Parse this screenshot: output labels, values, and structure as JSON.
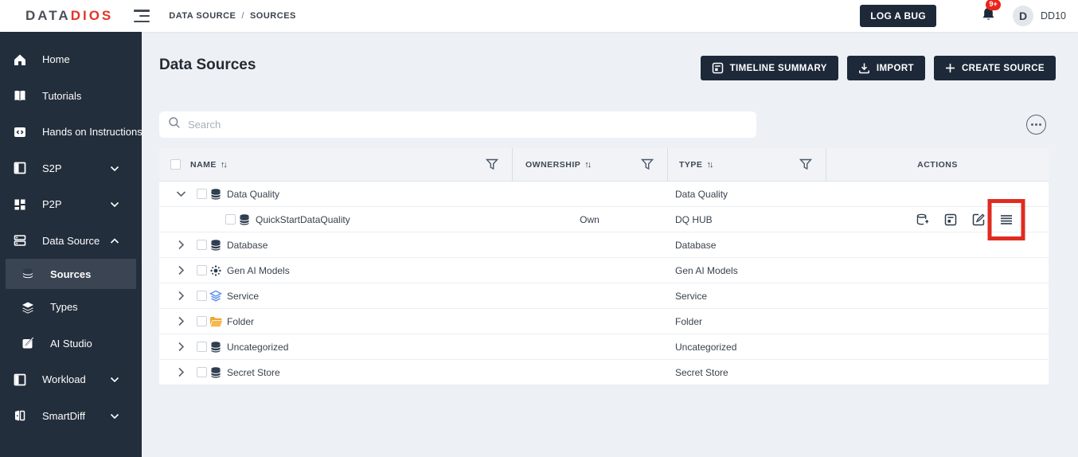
{
  "topbar": {
    "logo_part1": "DATA",
    "logo_part2": "DIOS",
    "breadcrumb_section": "DATA SOURCE",
    "breadcrumb_separator": "/",
    "breadcrumb_page": "SOURCES",
    "log_a_bug_label": "LOG A BUG",
    "notification_count": "9+",
    "avatar_initial": "D",
    "username": "DD10"
  },
  "sidebar": {
    "items": [
      {
        "label": "Home",
        "icon": "home-icon"
      },
      {
        "label": "Tutorials",
        "icon": "book-icon"
      },
      {
        "label": "Hands on Instructions",
        "icon": "code-badge-icon"
      },
      {
        "label": "S2P",
        "icon": "layout-icon",
        "chevron": "down"
      },
      {
        "label": "P2P",
        "icon": "grid-icon",
        "chevron": "down"
      },
      {
        "label": "Data Source",
        "icon": "server-icon",
        "chevron": "up"
      },
      {
        "label": "Sources",
        "icon": "database-icon",
        "child": true,
        "active": true
      },
      {
        "label": "Types",
        "icon": "layers-icon",
        "child": true
      },
      {
        "label": "AI Studio",
        "icon": "edit-icon",
        "child": true
      },
      {
        "label": "Workload",
        "icon": "layout-icon",
        "chevron": "down"
      },
      {
        "label": "SmartDiff",
        "icon": "diff-icon",
        "chevron": "down"
      }
    ]
  },
  "main": {
    "title": "Data Sources",
    "buttons": [
      {
        "label": "TIMELINE SUMMARY",
        "icon": "timeline-icon"
      },
      {
        "label": "IMPORT",
        "icon": "import-icon"
      },
      {
        "label": "CREATE SOURCE",
        "icon": "plus-icon"
      }
    ],
    "search_placeholder": "Search"
  },
  "table": {
    "sort_glyph": "↑↓",
    "columns": [
      {
        "label": "NAME",
        "sortable": true,
        "filterable": true
      },
      {
        "label": "OWNERSHIP",
        "sortable": true,
        "filterable": true
      },
      {
        "label": "TYPE",
        "sortable": true,
        "filterable": true
      },
      {
        "label": "ACTIONS",
        "sortable": false,
        "filterable": false
      }
    ],
    "rows": [
      {
        "name": "Data Quality",
        "icon": "database-icon",
        "chevron": "expanded",
        "child": false,
        "ownership": "",
        "type": "Data Quality",
        "actions": []
      },
      {
        "name": "QuickStartDataQuality",
        "icon": "database-icon",
        "chevron": null,
        "child": true,
        "ownership": "Own",
        "type": "DQ HUB",
        "actions": [
          "add-database-icon",
          "summary-icon",
          "edit-square-icon",
          "menu-icon"
        ],
        "highlighted_action": "menu-icon"
      },
      {
        "name": "Database",
        "icon": "database-icon",
        "chevron": "collapsed",
        "child": false,
        "ownership": "",
        "type": "Database",
        "actions": []
      },
      {
        "name": "Gen AI Models",
        "icon": "ai-icon",
        "chevron": "collapsed",
        "child": false,
        "ownership": "",
        "type": "Gen AI Models",
        "actions": []
      },
      {
        "name": "Service",
        "icon": "layers-blue-icon",
        "chevron": "collapsed",
        "child": false,
        "ownership": "",
        "type": "Service",
        "actions": []
      },
      {
        "name": "Folder",
        "icon": "folder-icon",
        "chevron": "collapsed",
        "child": false,
        "ownership": "",
        "type": "Folder",
        "actions": []
      },
      {
        "name": "Uncategorized",
        "icon": "database-icon",
        "chevron": "collapsed",
        "child": false,
        "ownership": "",
        "type": "Uncategorized",
        "actions": []
      },
      {
        "name": "Secret Store",
        "icon": "database-icon",
        "chevron": "collapsed",
        "child": false,
        "ownership": "",
        "type": "Secret Store",
        "actions": []
      }
    ]
  },
  "colors": {
    "sidebar_bg": "#232e3c",
    "button_bg": "#1d2939",
    "logo_accent": "#e23429",
    "highlight_red": "#e02b20",
    "notification_red": "#e8251c",
    "page_bg": "#edf1f6"
  }
}
